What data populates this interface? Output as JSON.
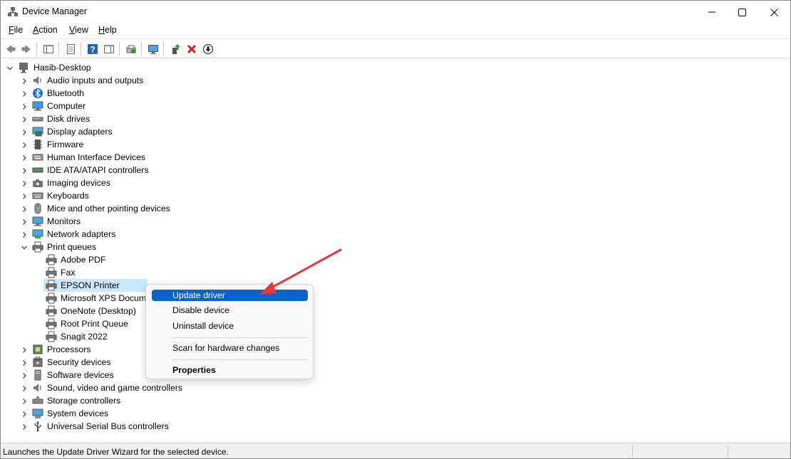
{
  "window": {
    "title": "Device Manager"
  },
  "menu": [
    {
      "label": "File",
      "ul": "F",
      "rest": "ile"
    },
    {
      "label": "Action",
      "ul": "A",
      "rest": "ction"
    },
    {
      "label": "View",
      "ul": "V",
      "rest": "iew"
    },
    {
      "label": "Help",
      "ul": "H",
      "rest": "elp"
    }
  ],
  "toolbar": [
    "back-icon",
    "forward-icon",
    "show-hide-console-tree-icon",
    "properties-icon",
    "help-icon",
    "action-pane-icon",
    "scan-hardware-icon",
    "monitor-icon",
    "update-driver-icon",
    "uninstall-icon",
    "download-icon"
  ],
  "tree": {
    "root": "Hasib-Desktop",
    "categories": [
      {
        "label": "Audio inputs and outputs",
        "icon": "speaker-icon"
      },
      {
        "label": "Bluetooth",
        "icon": "bluetooth-icon"
      },
      {
        "label": "Computer",
        "icon": "computer-icon"
      },
      {
        "label": "Disk drives",
        "icon": "disk-drive-icon"
      },
      {
        "label": "Display adapters",
        "icon": "display-adapter-icon"
      },
      {
        "label": "Firmware",
        "icon": "firmware-icon"
      },
      {
        "label": "Human Interface Devices",
        "icon": "hid-icon"
      },
      {
        "label": "IDE ATA/ATAPI controllers",
        "icon": "ide-controller-icon"
      },
      {
        "label": "Imaging devices",
        "icon": "camera-icon"
      },
      {
        "label": "Keyboards",
        "icon": "keyboard-icon"
      },
      {
        "label": "Mice and other pointing devices",
        "icon": "mouse-icon"
      },
      {
        "label": "Monitors",
        "icon": "monitor-icon"
      },
      {
        "label": "Network adapters",
        "icon": "network-icon"
      },
      {
        "label": "Print queues",
        "icon": "printer-icon"
      }
    ],
    "print_queues": [
      "Adobe PDF",
      "Fax",
      "EPSON Printer",
      "Microsoft XPS Docume",
      "OneNote (Desktop)",
      "Root Print Queue",
      "Snagit 2022"
    ],
    "selected": "EPSON Printer",
    "categories_after": [
      {
        "label": "Processors",
        "icon": "processor-icon"
      },
      {
        "label": "Security devices",
        "icon": "security-icon"
      },
      {
        "label": "Software devices",
        "icon": "software-device-icon"
      },
      {
        "label": "Sound, video and game controllers",
        "icon": "speaker-icon"
      },
      {
        "label": "Storage controllers",
        "icon": "storage-controller-icon"
      },
      {
        "label": "System devices",
        "icon": "system-device-icon"
      },
      {
        "label": "Universal Serial Bus controllers",
        "icon": "usb-icon"
      }
    ]
  },
  "context_menu": {
    "update": "Update driver",
    "disable": "Disable device",
    "uninstall": "Uninstall device",
    "scan": "Scan for hardware changes",
    "properties": "Properties"
  },
  "status": "Launches the Update Driver Wizard for the selected device.",
  "colors": {
    "accent": "#0a64c8",
    "selection": "#cce8ff",
    "arrow": "#e0393e"
  }
}
